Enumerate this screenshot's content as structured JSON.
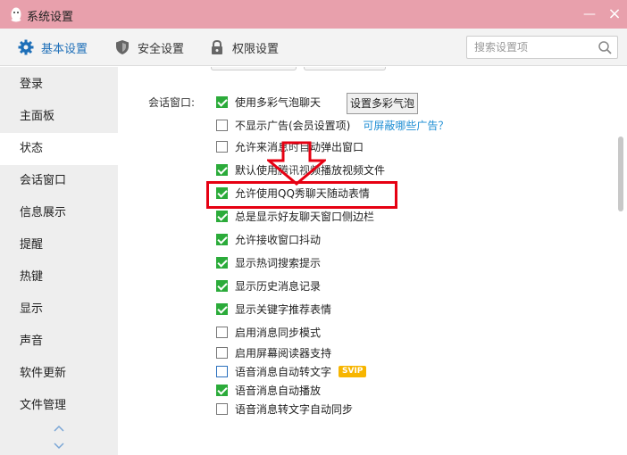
{
  "window": {
    "title": "系统设置",
    "minimize": "—",
    "close": "×"
  },
  "tabs": [
    {
      "label": "基本设置",
      "icon": "gear-icon",
      "active": true
    },
    {
      "label": "安全设置",
      "icon": "shield-icon",
      "active": false
    },
    {
      "label": "权限设置",
      "icon": "lock-icon",
      "active": false
    }
  ],
  "search": {
    "placeholder": "搜索设置项",
    "value": ""
  },
  "sidebar": {
    "items": [
      {
        "label": "登录",
        "active": false
      },
      {
        "label": "主面板",
        "active": false
      },
      {
        "label": "状态",
        "active": true
      },
      {
        "label": "会话窗口",
        "active": false
      },
      {
        "label": "信息展示",
        "active": false
      },
      {
        "label": "提醒",
        "active": false
      },
      {
        "label": "热键",
        "active": false
      },
      {
        "label": "显示",
        "active": false
      },
      {
        "label": "声音",
        "active": false
      },
      {
        "label": "软件更新",
        "active": false
      },
      {
        "label": "文件管理",
        "active": false
      }
    ]
  },
  "section": {
    "label": "会话窗口:",
    "bubble_button": "设置多彩气泡",
    "ad_link": "可屏蔽哪些广告？",
    "vip_badge": "SVIP",
    "options": [
      {
        "label": "使用多彩气泡聊天",
        "checked": true
      },
      {
        "label": "不显示广告(会员设置项)",
        "checked": false
      },
      {
        "label": "允许来消息时自动弹出窗口",
        "checked": false
      },
      {
        "label": "默认使用腾讯视频播放视频文件",
        "checked": true
      },
      {
        "label": "允许使用QQ秀聊天随动表情",
        "checked": true,
        "highlighted": true
      },
      {
        "label": "总是显示好友聊天窗口侧边栏",
        "checked": true
      },
      {
        "label": "允许接收窗口抖动",
        "checked": true
      },
      {
        "label": "显示热词搜索提示",
        "checked": true
      },
      {
        "label": "显示历史消息记录",
        "checked": true
      },
      {
        "label": "显示关键字推荐表情",
        "checked": true
      },
      {
        "label": "启用消息同步模式",
        "checked": false
      },
      {
        "label": "启用屏幕阅读器支持",
        "checked": false
      },
      {
        "label": "语音消息自动转文字",
        "checked": false
      },
      {
        "label": "语音消息自动播放",
        "checked": true
      },
      {
        "label": "语音消息转文字自动同步",
        "checked": false
      }
    ]
  },
  "colors": {
    "titlebar": "#e8a0ac",
    "accent": "#1e6fb8",
    "checkbox_checked": "#2bab3a",
    "annotation_red": "#e60012",
    "vip": "#f7b500"
  }
}
